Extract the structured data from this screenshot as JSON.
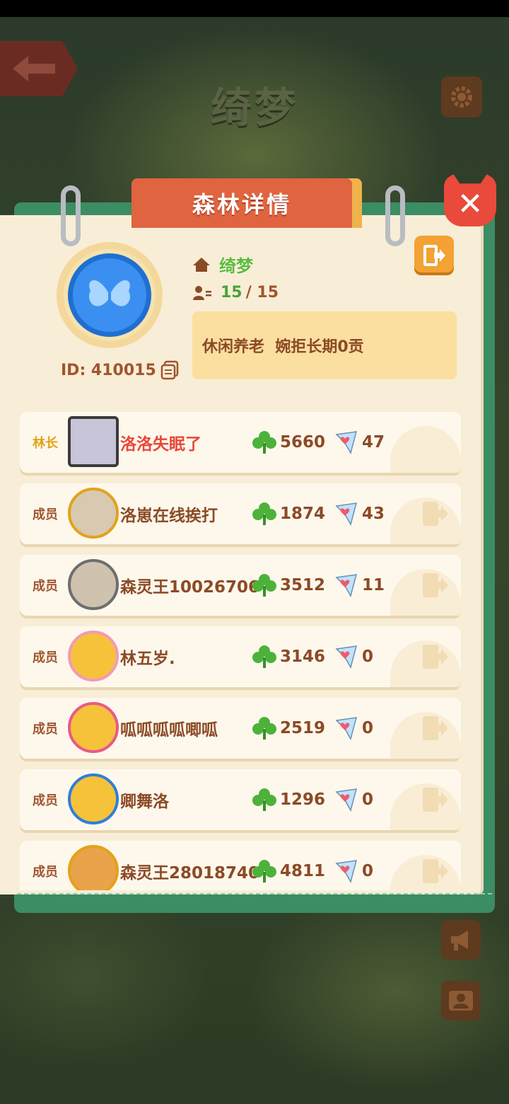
{
  "header": {
    "forest_name": "绮梦"
  },
  "panel": {
    "title": "森林详情",
    "close_glyph": "✕"
  },
  "forest": {
    "name": "绮梦",
    "id_label": "ID: 410015",
    "member_count": "15",
    "member_max": "/ 15",
    "announcement": "休闲养老  婉拒长期0贡",
    "emblem_color": "#3b8ff0"
  },
  "members": [
    {
      "role": "林长",
      "role_color": "#e3a21a",
      "name": "洛洛失眠了",
      "name_color": "#e8473a",
      "score": "5660",
      "gifts": "47",
      "kick": false,
      "avatar": "#c9c5d8"
    },
    {
      "role": "成员",
      "role_color": "#a0552e",
      "name": "洛崽在线挨打",
      "name_color": "#8b4a26",
      "score": "1874",
      "gifts": "43",
      "kick": true,
      "avatar": "#d8c9b0"
    },
    {
      "role": "成员",
      "role_color": "#a0552e",
      "name": "森灵王10026706",
      "name_color": "#8b4a26",
      "score": "3512",
      "gifts": "11",
      "kick": true,
      "avatar": "#cfc2ae"
    },
    {
      "role": "成员",
      "role_color": "#a0552e",
      "name": "林五岁.",
      "name_color": "#8b4a26",
      "score": "3146",
      "gifts": "0",
      "kick": true,
      "avatar": "#f6c23a"
    },
    {
      "role": "成员",
      "role_color": "#a0552e",
      "name": "呱呱呱呱唧呱",
      "name_color": "#8b4a26",
      "score": "2519",
      "gifts": "0",
      "kick": true,
      "avatar": "#f6c23a"
    },
    {
      "role": "成员",
      "role_color": "#a0552e",
      "name": "卿舞洛",
      "name_color": "#8b4a26",
      "score": "1296",
      "gifts": "0",
      "kick": true,
      "avatar": "#f6c23a"
    },
    {
      "role": "成员",
      "role_color": "#a0552e",
      "name": "森灵王28018740",
      "name_color": "#8b4a26",
      "score": "4811",
      "gifts": "0",
      "kick": true,
      "avatar": "#e9a34a"
    }
  ],
  "icons": {
    "back": "arrow-left-icon",
    "settings": "gear-icon",
    "home": "home-icon",
    "people": "people-icon",
    "copy": "copy-icon",
    "leave": "exit-door-icon",
    "score": "clover-icon",
    "gift": "heart-flag-icon",
    "announce": "megaphone-icon",
    "contacts": "contact-card-icon"
  }
}
